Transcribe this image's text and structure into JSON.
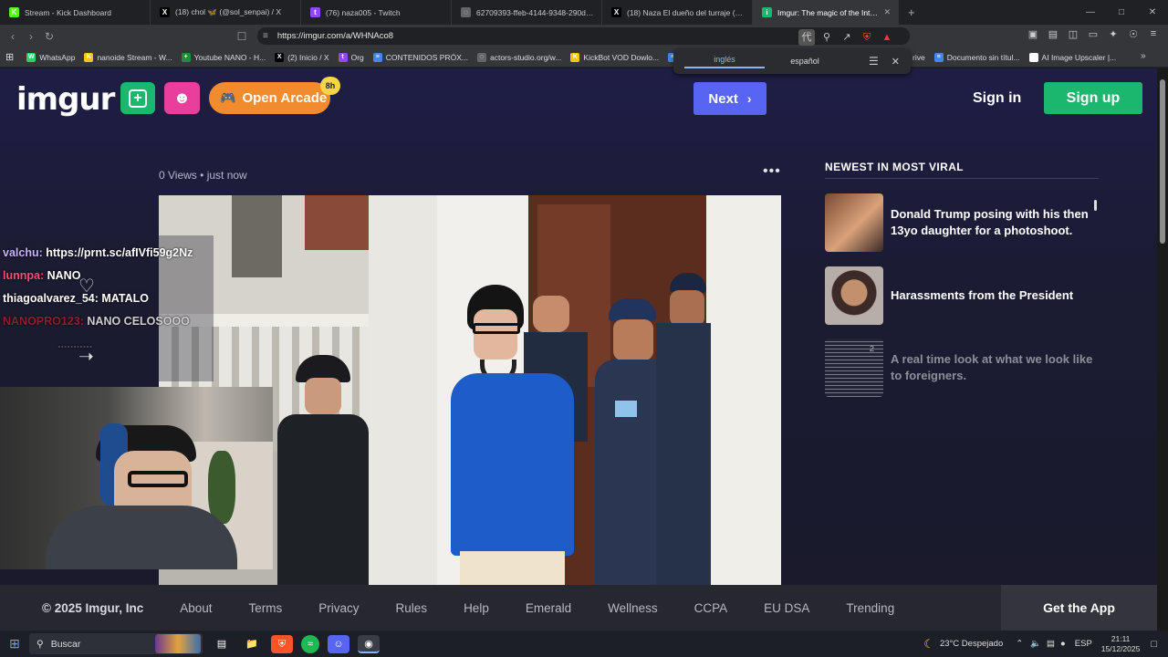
{
  "tabs": [
    {
      "title": "Stream - Kick Dashboard",
      "fav_color": "#53fc18",
      "fav_char": "K"
    },
    {
      "title": "(18) chol 🦋 (@sol_senpai) / X",
      "fav_color": "#000000",
      "fav_char": "X"
    },
    {
      "title": "(76) naza005 - Twitch",
      "fav_color": "#9146ff",
      "fav_char": "t"
    },
    {
      "title": "62709393-ffeb-4144-9348-290d93d…",
      "fav_color": "#666666",
      "fav_char": "◌"
    },
    {
      "title": "(18) Naza El dueño del turraje (@Ma…",
      "fav_color": "#000000",
      "fav_char": "X"
    },
    {
      "title": "Imgur: The magic of the Internet",
      "fav_color": "#1bb76e",
      "fav_char": "i"
    }
  ],
  "address": {
    "url": "https://imgur.com/a/WHNAco8"
  },
  "bookmarks": [
    {
      "label": "WhatsApp",
      "color": "#25d366",
      "ch": "W"
    },
    {
      "label": "nanoide Stream - W...",
      "color": "#f5c518",
      "ch": "K"
    },
    {
      "label": "Youtube NANO - H...",
      "color": "#1e8e3e",
      "ch": "+"
    },
    {
      "label": "(2) Inicio / X",
      "color": "#000000",
      "ch": "X"
    },
    {
      "label": "Org",
      "color": "#9146ff",
      "ch": "t"
    },
    {
      "label": "CONTENIDOS PRÓX...",
      "color": "#4285f4",
      "ch": "≡"
    },
    {
      "label": "actors-studio.org/w...",
      "color": "#666666",
      "ch": "◌"
    },
    {
      "label": "KickBot VOD Dowlo...",
      "color": "#f5c518",
      "ch": "K"
    },
    {
      "label": "",
      "color": "#4285f4",
      "ch": "≡"
    }
  ],
  "bookmarks_right": [
    {
      "label": "rive",
      "color": "",
      "ch": ""
    },
    {
      "label": "Documento sin títul...",
      "color": "#4285f4",
      "ch": "≡"
    },
    {
      "label": "AI Image Upscaler |...",
      "color": "#ffffff",
      "ch": "AI"
    }
  ],
  "translate": {
    "from": "inglés",
    "to": "español"
  },
  "imgur": {
    "logo": "imgur",
    "arcade": "Open Arcade",
    "arcade_badge": "8h",
    "next": "Next",
    "sign_in": "Sign in",
    "sign_up": "Sign up",
    "views": "0 Views",
    "time": "just now",
    "sidebar_title": "NEWEST IN MOST VIRAL",
    "posts": [
      {
        "title": "Donald Trump posing with his then 13yo daughter for a photoshoot.",
        "count": ""
      },
      {
        "title": "Harassments from the President",
        "count": ""
      },
      {
        "title": "A real time look at what we look like to foreigners.",
        "count": "2"
      }
    ]
  },
  "chat": [
    {
      "user": "valchu",
      "msg": "https://prnt.sc/afIVfi59g2Nz"
    },
    {
      "user": "lunnpa",
      "msg": "NANO"
    },
    {
      "user": "thiagoalvarez_54",
      "msg": "MATALO"
    },
    {
      "user": "NANOPRO123",
      "msg": "NANO CELOSOOO"
    }
  ],
  "chat_faint": "...........",
  "footer": {
    "copyright": "© 2025 Imgur, Inc",
    "links": [
      "About",
      "Terms",
      "Privacy",
      "Rules",
      "Help",
      "Emerald",
      "Wellness",
      "CCPA",
      "EU DSA",
      "Trending"
    ],
    "get_app": "Get the App"
  },
  "taskbar": {
    "search": "Buscar",
    "weather": "23°C  Despejado",
    "lang": "ESP",
    "time": "21:11",
    "date": "15/12/2025"
  },
  "colors": {
    "imgur_green": "#1bb76e",
    "next_blue": "#5865f2",
    "arcade_orange": "#f28b2e"
  }
}
